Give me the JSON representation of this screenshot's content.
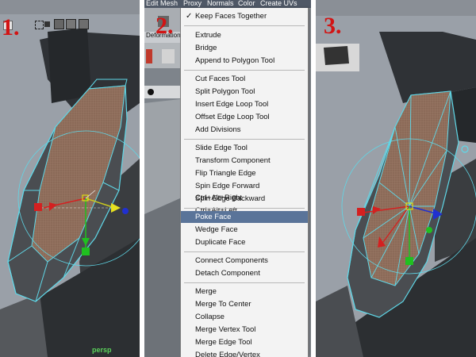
{
  "steps": [
    "1.",
    "2.",
    "3."
  ],
  "viewport1": {
    "camera_label": "persp"
  },
  "menubar": {
    "items": [
      "Edit Mesh",
      "Proxy",
      "Normals",
      "Color",
      "Create UVs"
    ]
  },
  "shelf": {
    "tab_label": "Deformation"
  },
  "menu": {
    "checked_item": "Keep Faces Together",
    "groups": [
      [
        "Extrude",
        "Bridge",
        "Append to Polygon Tool"
      ],
      [
        "Cut Faces Tool",
        "Split Polygon Tool",
        "Insert Edge Loop Tool",
        "Offset Edge Loop Tool",
        "Add Divisions"
      ],
      [
        "Slide Edge Tool",
        "Transform Component",
        "Flip Triangle Edge",
        "Spin Edge Forward  Ctrl+Alt+Right",
        "Spin Edge Backward  Ctrl+Alt+Left"
      ],
      [
        "Poke Face",
        "Wedge Face",
        "Duplicate Face"
      ],
      [
        "Connect Components",
        "Detach Component"
      ],
      [
        "Merge",
        "Merge To Center",
        "Collapse",
        "Merge Vertex Tool",
        "Merge Edge Tool",
        "Delete Edge/Vertex"
      ]
    ],
    "highlighted_item": "Poke Face"
  },
  "colors": {
    "selection_edge": "#5fd8e8",
    "selected_face_fill": "#8b6a58",
    "mesh_gray": "#3c3f43",
    "menu_highlight": "#5a7499",
    "step_number": "#d21414",
    "manip_x": "#d42020",
    "manip_y": "#20c020",
    "manip_z": "#2030d0"
  }
}
